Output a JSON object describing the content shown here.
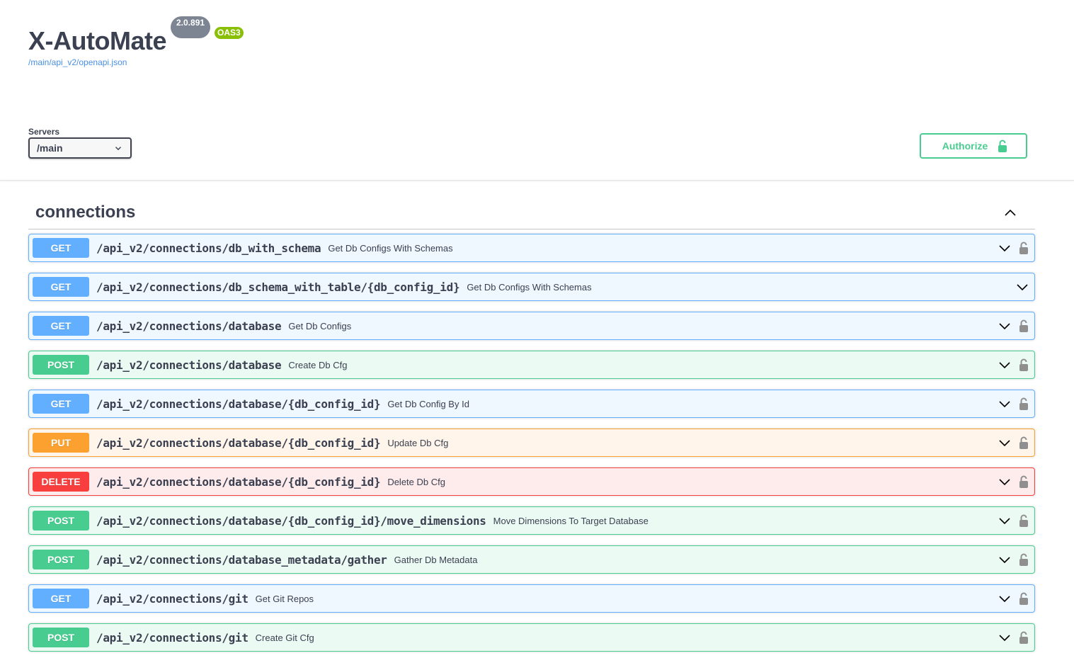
{
  "info": {
    "title": "X-AutoMate",
    "version": "2.0.891",
    "oas_badge": "OAS3",
    "spec_link": "/main/api_v2/openapi.json"
  },
  "servers": {
    "label": "Servers",
    "selected": "/main"
  },
  "authorize": {
    "label": "Authorize",
    "icon": "unlock-icon"
  },
  "colors": {
    "get": "#61affe",
    "post": "#49cc90",
    "put": "#fca130",
    "delete": "#f93e3e",
    "authorize": "#49cc90"
  },
  "tag": {
    "name": "connections",
    "expanded": true,
    "operations": [
      {
        "method": "GET",
        "path": "/api_v2/connections/db_with_schema",
        "summary": "Get Db Configs With Schemas",
        "locked": true
      },
      {
        "method": "GET",
        "path": "/api_v2/connections/db_schema_with_table/{db_config_id}",
        "summary": "Get Db Configs With Schemas",
        "locked": false
      },
      {
        "method": "GET",
        "path": "/api_v2/connections/database",
        "summary": "Get Db Configs",
        "locked": true
      },
      {
        "method": "POST",
        "path": "/api_v2/connections/database",
        "summary": "Create Db Cfg",
        "locked": true
      },
      {
        "method": "GET",
        "path": "/api_v2/connections/database/{db_config_id}",
        "summary": "Get Db Config By Id",
        "locked": true
      },
      {
        "method": "PUT",
        "path": "/api_v2/connections/database/{db_config_id}",
        "summary": "Update Db Cfg",
        "locked": true
      },
      {
        "method": "DELETE",
        "path": "/api_v2/connections/database/{db_config_id}",
        "summary": "Delete Db Cfg",
        "locked": true
      },
      {
        "method": "POST",
        "path": "/api_v2/connections/database/{db_config_id}/move_dimensions",
        "summary": "Move Dimensions To Target Database",
        "locked": true
      },
      {
        "method": "POST",
        "path": "/api_v2/connections/database_metadata/gather",
        "summary": "Gather Db Metadata",
        "locked": true
      },
      {
        "method": "GET",
        "path": "/api_v2/connections/git",
        "summary": "Get Git Repos",
        "locked": true
      },
      {
        "method": "POST",
        "path": "/api_v2/connections/git",
        "summary": "Create Git Cfg",
        "locked": true
      }
    ]
  }
}
